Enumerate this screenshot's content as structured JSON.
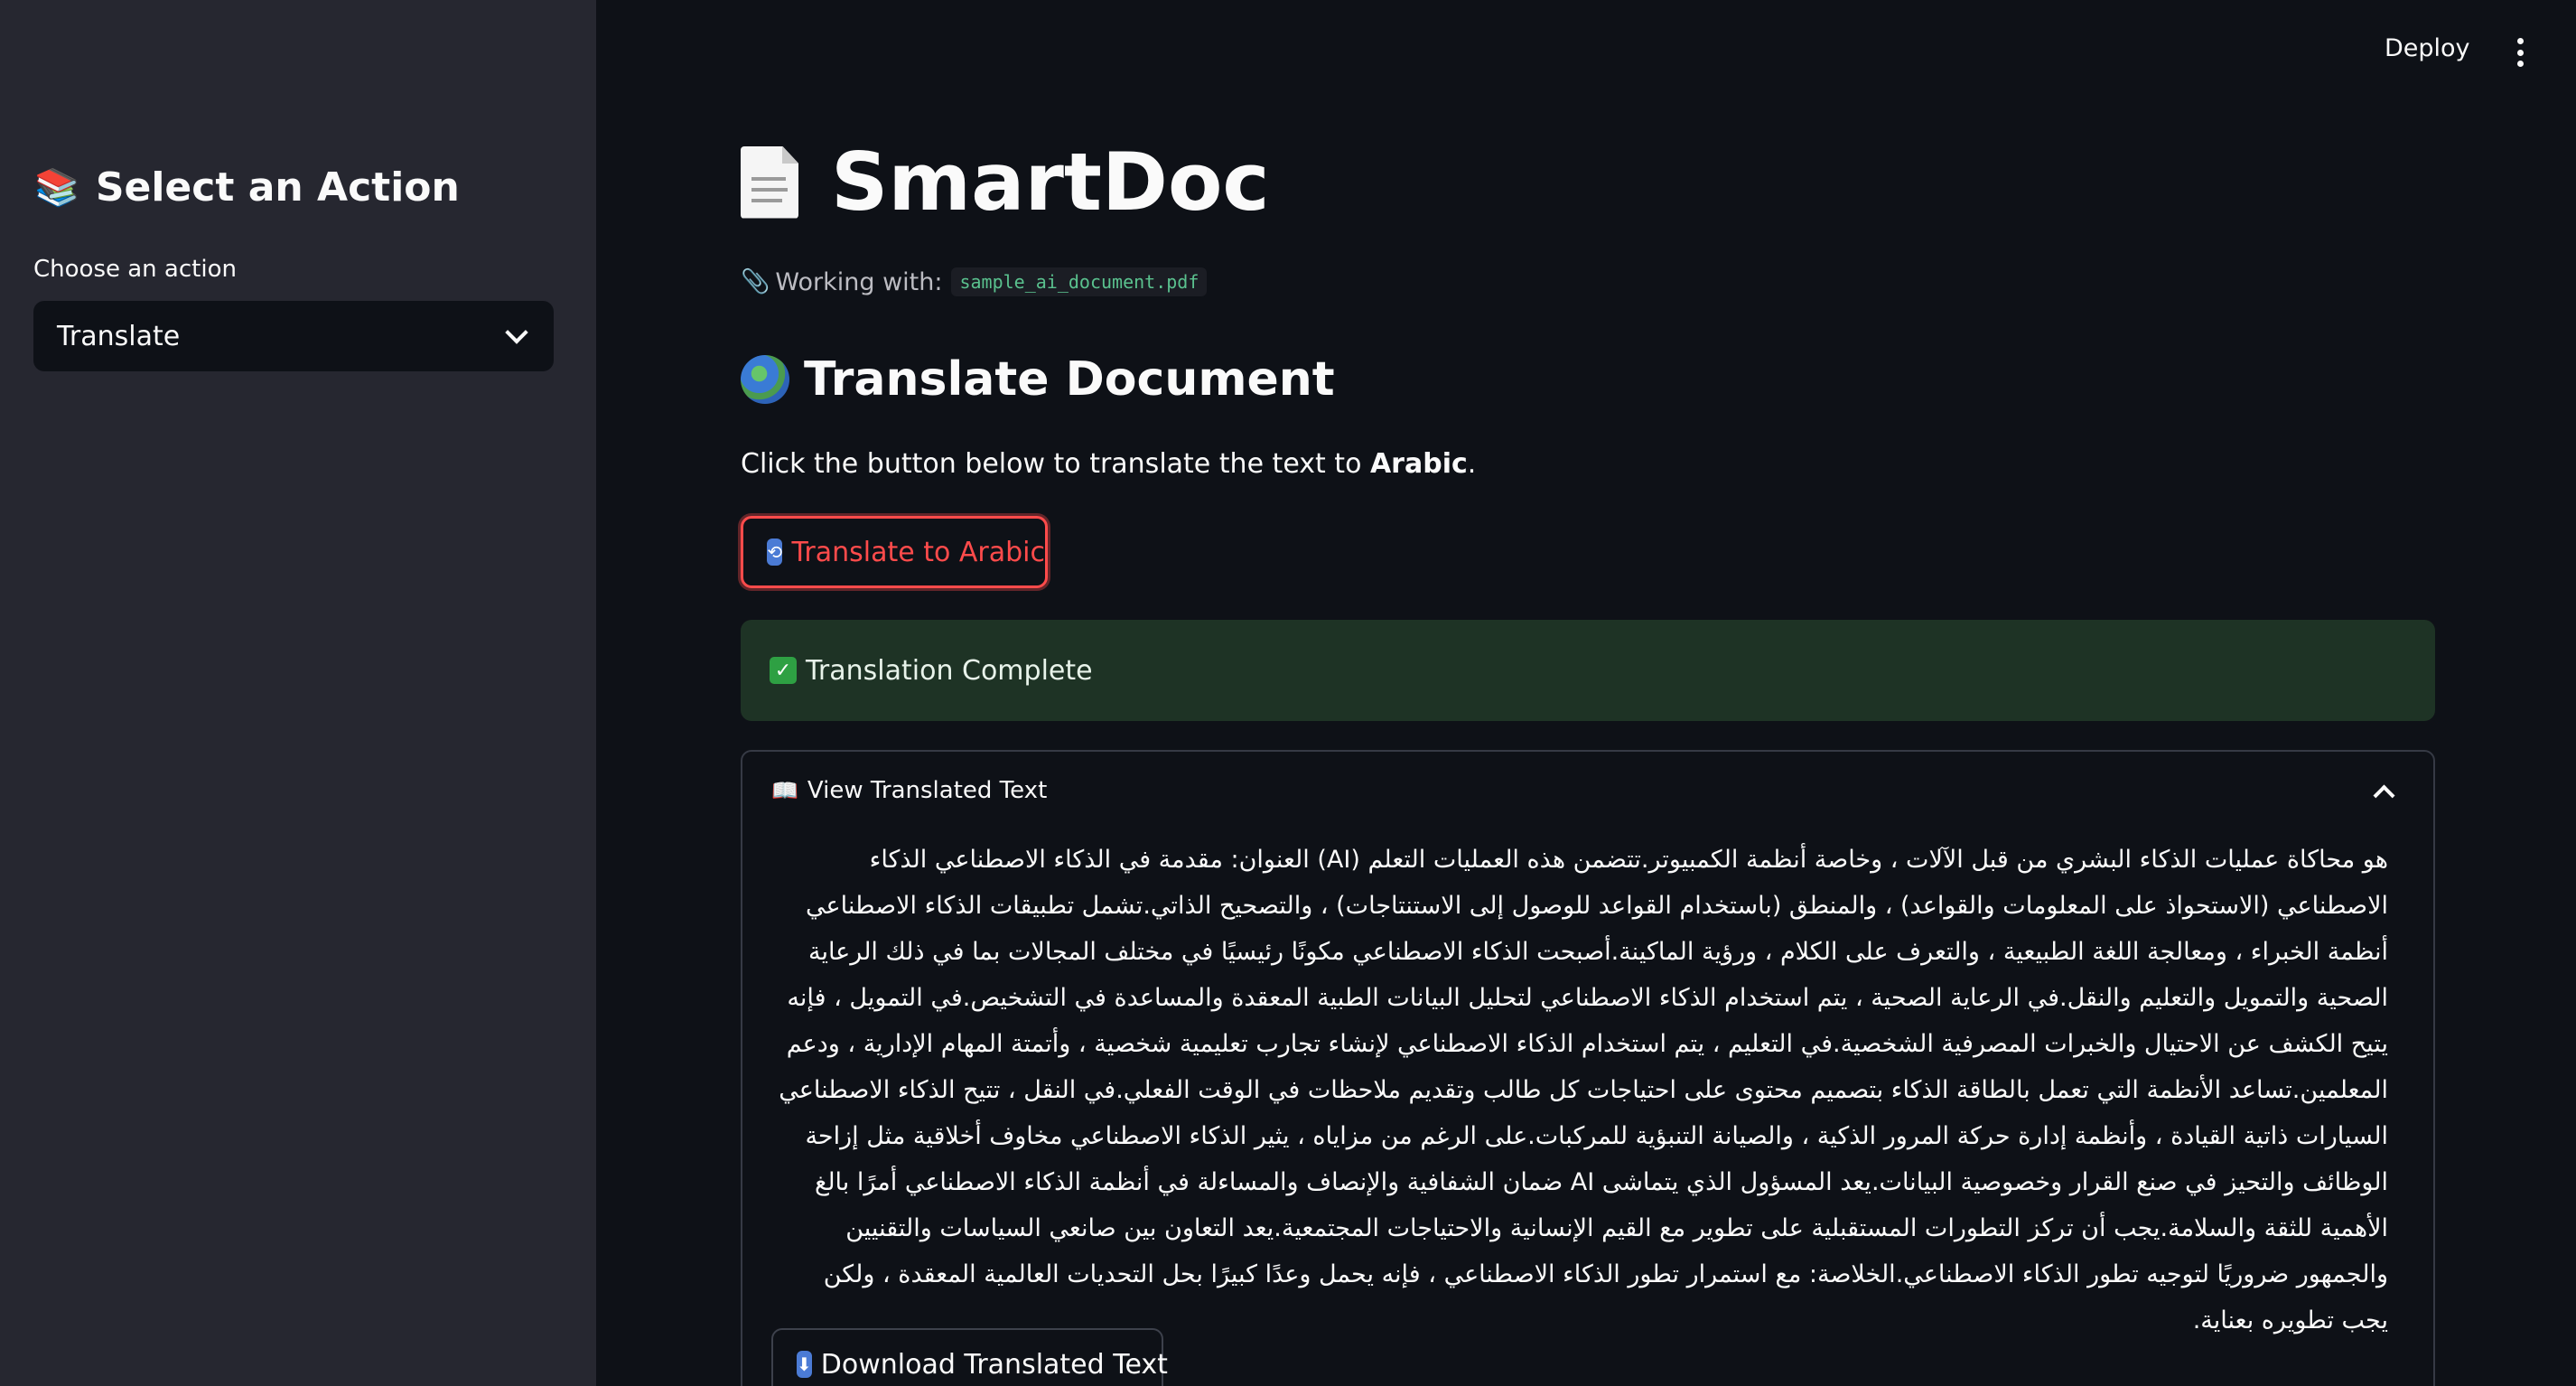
{
  "sidebar": {
    "title": "Select an Action",
    "title_icon": "books-icon",
    "select_label": "Choose an action",
    "select_value": "Translate"
  },
  "header": {
    "deploy_label": "Deploy",
    "menu_icon": "more-vertical-icon"
  },
  "main": {
    "title": "SmartDoc",
    "title_icon": "document-icon",
    "working_with_label": "Working with:",
    "file_name": "sample_ai_document.pdf",
    "section_title": "Translate Document",
    "instruction_prefix": "Click the button below to translate the text to ",
    "instruction_language": "Arabic",
    "instruction_suffix": ".",
    "translate_button": "Translate to Arabic",
    "success_message": "Translation Complete",
    "expander_label": "View Translated Text",
    "translated_text": "هو محاكاة عمليات الذكاء البشري من قبل الآلات ، وخاصة أنظمة الكمبيوتر.تتضمن هذه العمليات التعلم (AI) العنوان: مقدمة في الذكاء الاصطناعي الذكاء الاصطناعي (الاستحواذ على المعلومات والقواعد) ، والمنطق (باستخدام القواعد للوصول إلى الاستنتاجات) ، والتصحيح الذاتي.تشمل تطبيقات الذكاء الاصطناعي أنظمة الخبراء ، ومعالجة اللغة الطبيعية ، والتعرف على الكلام ، ورؤية الماكينة.أصبحت الذكاء الاصطناعي مكونًا رئيسيًا في مختلف المجالات بما في ذلك الرعاية الصحية والتمويل والتعليم والنقل.في الرعاية الصحية ، يتم استخدام الذكاء الاصطناعي لتحليل البيانات الطبية المعقدة والمساعدة في التشخيص.في التمويل ، فإنه يتيح الكشف عن الاحتيال والخبرات المصرفية الشخصية.في التعليم ، يتم استخدام الذكاء الاصطناعي لإنشاء تجارب تعليمية شخصية ، وأتمتة المهام الإدارية ، ودعم المعلمين.تساعد الأنظمة التي تعمل بالطاقة الذكاء بتصميم محتوى على احتياجات كل طالب وتقديم ملاحظات في الوقت الفعلي.في النقل ، تتيح الذكاء الاصطناعي السيارات ذاتية القيادة ، وأنظمة إدارة حركة المرور الذكية ، والصيانة التنبؤية للمركبات.على الرغم من مزاياه ، يثير الذكاء الاصطناعي مخاوف أخلاقية مثل إزاحة الوظائف والتحيز في صنع القرار وخصوصية البيانات.يعد المسؤول الذي يتماشى AI ضمان الشفافية والإنصاف والمساءلة في أنظمة الذكاء الاصطناعي أمرًا بالغ الأهمية للثقة والسلامة.يجب أن تركز التطورات المستقبلية على تطوير مع القيم الإنسانية والاحتياجات المجتمعية.يعد التعاون بين صانعي السياسات والتقنيين والجمهور ضروريًا لتوجيه تطور الذكاء الاصطناعي.الخلاصة: مع استمرار تطور الذكاء الاصطناعي ، فإنه يحمل وعدًا كبيرًا بحل التحديات العالمية المعقدة ، ولكن يجب تطويره بعناية.",
    "download_button": "Download Translated Text"
  }
}
